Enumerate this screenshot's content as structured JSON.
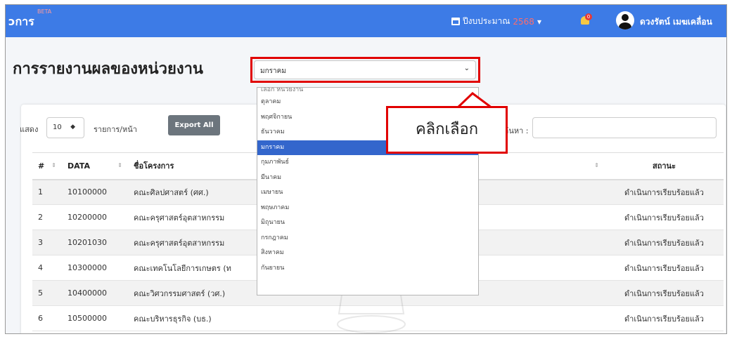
{
  "topbar": {
    "brand": "ɔการ",
    "beta": "BETA",
    "fiscal_label": "ปีงบประมาณ",
    "fiscal_year": "2568",
    "fiscal_caret": "▾",
    "notification_count": "0",
    "user_name": "ดวงรัตน์ เมฆเคลื่อน",
    "accent": "#3d7be6"
  },
  "page": {
    "title": "การรายงานผลของหน่วยงาน"
  },
  "month_select": {
    "value": "มกราคม",
    "options": [
      "เลือก หน่วยงาน",
      "ตุลาคม",
      "พฤศจิกายน",
      "ธันวาคม",
      "มกราคม",
      "กุมภาพันธ์",
      "มีนาคม",
      "เมษายน",
      "พฤษภาคม",
      "มิถุนายน",
      "กรกฎาคม",
      "สิงหาคม",
      "กันยายน"
    ],
    "selected_index": 4
  },
  "callout": {
    "text": "คลิกเลือก"
  },
  "controls": {
    "show_label": "แสดง",
    "page_length": "10",
    "per_page_label": "รายการ/หน้า",
    "export_label": "Export All",
    "search_label": "ค้นหา :"
  },
  "table": {
    "headers": [
      "#",
      "DATA",
      "ชื่อโครงการ",
      "สถานะ"
    ],
    "rows": [
      [
        "1",
        "10100000",
        "คณะศิลปศาสตร์ (ศศ.)",
        "ดำเนินการเรียบร้อยแล้ว"
      ],
      [
        "2",
        "10200000",
        "คณะครุศาสตร์อุตสาหกรรม",
        "ดำเนินการเรียบร้อยแล้ว"
      ],
      [
        "3",
        "10201030",
        "คณะครุศาสตร์อุตสาหกรรม",
        "ดำเนินการเรียบร้อยแล้ว"
      ],
      [
        "4",
        "10300000",
        "คณะเทคโนโลยีการเกษตร (ท",
        "ดำเนินการเรียบร้อยแล้ว"
      ],
      [
        "5",
        "10400000",
        "คณะวิศวกรรมศาสตร์ (วศ.)",
        "ดำเนินการเรียบร้อยแล้ว"
      ],
      [
        "6",
        "10500000",
        "คณะบริหารธุรกิจ (บธ.)",
        "ดำเนินการเรียบร้อยแล้ว"
      ]
    ],
    "status_color": "#28a745"
  }
}
